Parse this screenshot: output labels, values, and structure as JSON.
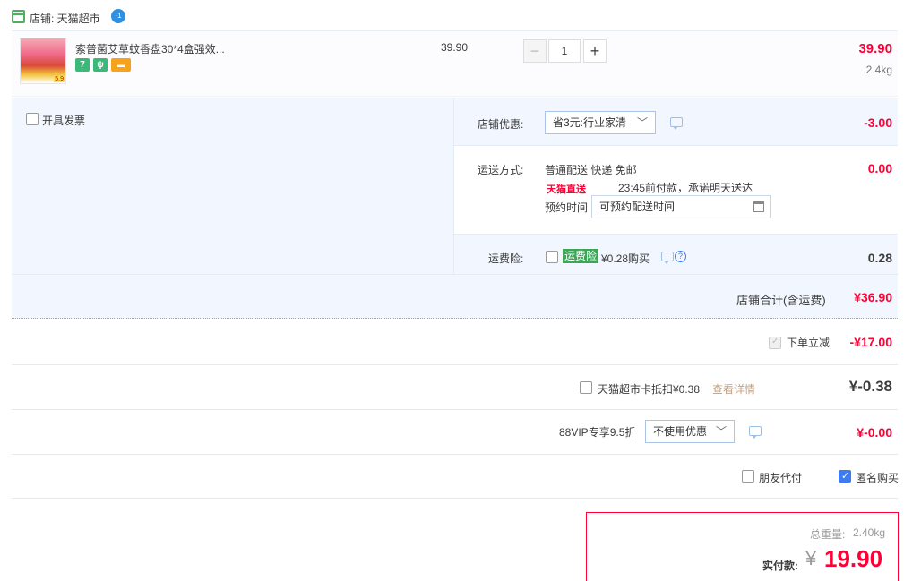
{
  "shop": {
    "label": "店铺: 天猫超市",
    "ww_badge": "·1"
  },
  "item": {
    "title": "索普菌艾草蚊香盘30*4盒强效...",
    "img_tag": "5.9",
    "badges": [
      {
        "text": "7",
        "color": "#3cb878"
      },
      {
        "text": "ψ",
        "color": "#3cb878"
      },
      {
        "text": "▬",
        "color": "#f7a21c"
      }
    ],
    "unit_price": "39.90",
    "quantity": "1",
    "minus": "−",
    "plus": "+",
    "total": "39.90",
    "weight": "2.4kg"
  },
  "invoice": {
    "label": "开具发票"
  },
  "shop_discount": {
    "label": "店铺优惠:",
    "selected": "省3元:行业家清",
    "value": "-3.00"
  },
  "delivery": {
    "label": "运送方式:",
    "method": "普通配送 快递 免邮",
    "tmall_logo": "天猫直送",
    "promise": "23:45前付款，承诺明天送达",
    "schedule_label": "预约时间",
    "schedule_value": "可预约配送时间",
    "value": "0.00"
  },
  "shipping_insurance": {
    "label": "运费险:",
    "tag": "运费险",
    "text": "¥0.28购买",
    "value": "0.28",
    "help": "?"
  },
  "shop_total": {
    "label": "店铺合计(含运费)",
    "value": "¥36.90"
  },
  "instant_discount": {
    "label": "下单立减",
    "value": "-¥17.00"
  },
  "card_deduct": {
    "label": "天猫超市卡抵扣¥0.38",
    "link": "查看详情",
    "value": "¥-0.38"
  },
  "vip": {
    "label": "88VIP专享9.5折",
    "selected": "不使用优惠",
    "value": "¥-0.00"
  },
  "friend_pay": {
    "label": "朋友代付"
  },
  "anonymous": {
    "label": "匿名购买"
  },
  "summary": {
    "weight_label": "总重量:",
    "weight_value": "2.40kg",
    "pay_label": "实付款:",
    "yen": "¥",
    "pay_value": "19.90"
  },
  "chev": "﹀"
}
